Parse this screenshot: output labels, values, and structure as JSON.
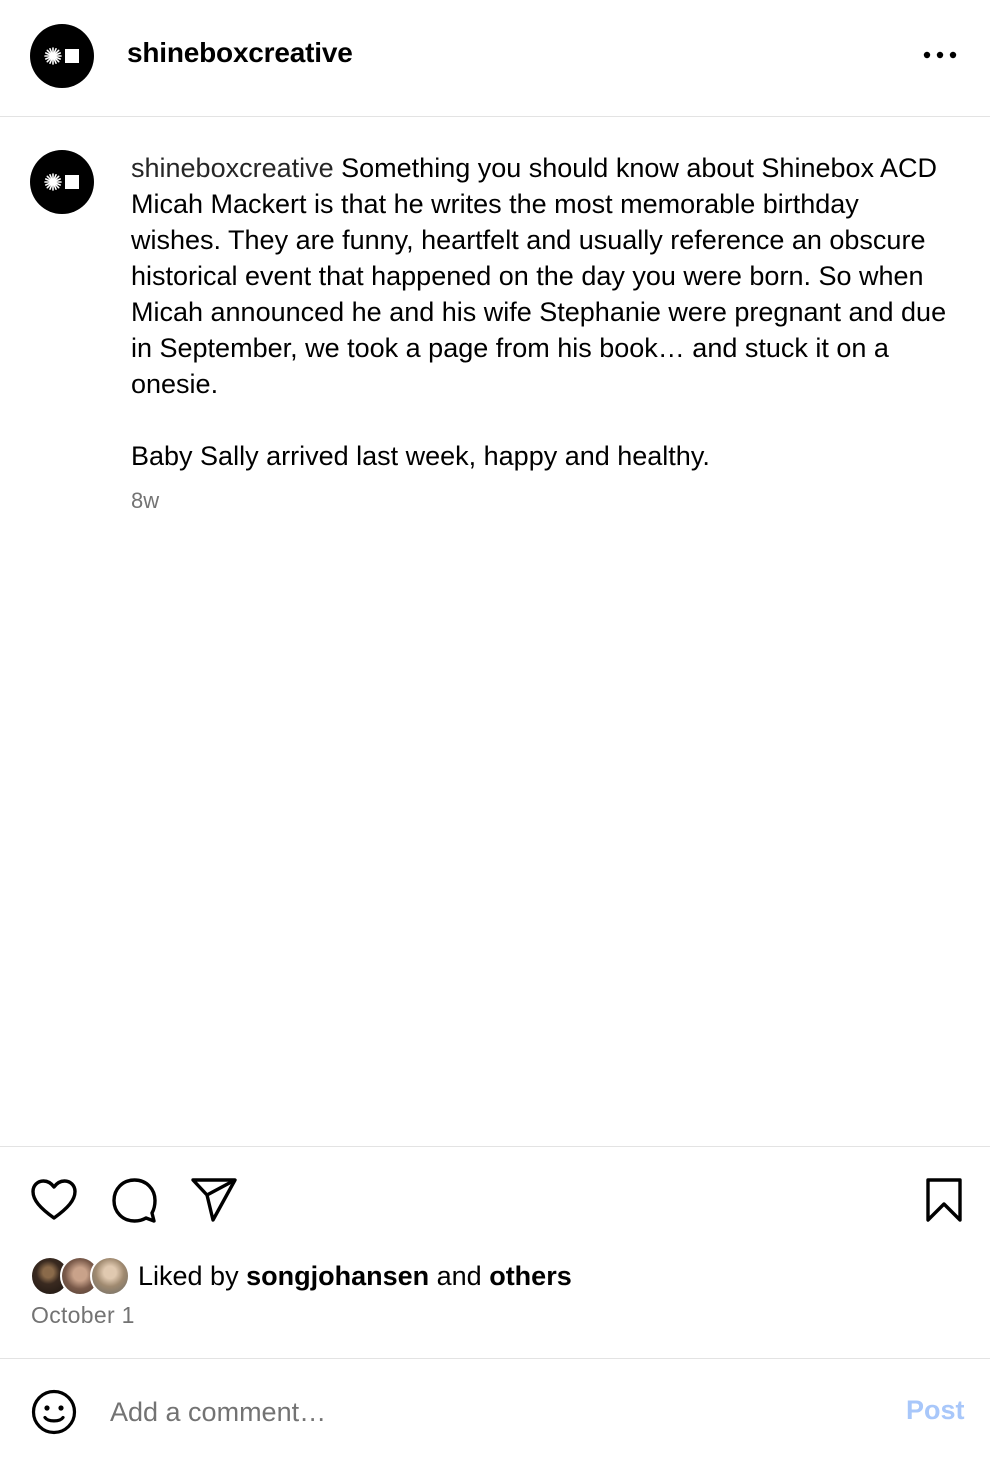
{
  "header": {
    "username": "shineboxcreative",
    "avatar_icon": "shinebox-logo-icon",
    "more_icon": "more-options-icon"
  },
  "caption": {
    "username": "shineboxcreative",
    "paragraph_1": "Something you should know about Shinebox ACD Micah Mackert is that he writes the most memorable birthday wishes. They are funny, heartfelt and usually reference an obscure historical event that happened on the day you were born. So when Micah announced he and his wife Stephanie were pregnant and due in September, we took a page from his book… and stuck it on a onesie.",
    "paragraph_2": "Baby Sally arrived last week, happy and healthy.",
    "timestamp": "8w"
  },
  "actions": {
    "like_icon": "heart-icon",
    "comment_icon": "comment-icon",
    "share_icon": "send-icon",
    "save_icon": "bookmark-icon"
  },
  "likes": {
    "prefix": "Liked by",
    "user": "songjohansen",
    "connector": "and",
    "others": "others"
  },
  "post_date": "October 1",
  "comment_box": {
    "emoji_icon": "emoji-icon",
    "placeholder": "Add a comment…",
    "post_label": "Post",
    "post_color": "#a8c7fa"
  }
}
